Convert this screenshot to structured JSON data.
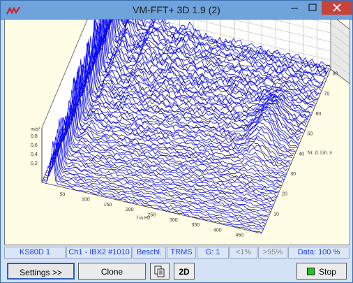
{
  "window": {
    "title": "VM-FFT+ 3D 1.9 (2)"
  },
  "plot": {
    "y_axis_label": "m/s²",
    "y_ticks": [
      "0,8",
      "0,6",
      "0,4",
      "0,2"
    ],
    "x_axis_label": "f in Hz",
    "x_ticks": [
      "50",
      "100",
      "150",
      "200",
      "250",
      "300",
      "350",
      "400",
      "450"
    ],
    "z_axis_label": "Nr. d. Lin. s",
    "z_ticks": [
      "10",
      "20",
      "30",
      "40",
      "50",
      "60",
      "70",
      "80"
    ],
    "trace_color": "#0000ff",
    "background_color": "#fffde6"
  },
  "status": {
    "sensor": "KS80D 1",
    "channel": "Ch1 - IBX2 #1010",
    "measure": "Beschl.",
    "mode": "TRMS",
    "gain": "G: 1",
    "low": "<1%",
    "high": ">95%",
    "data": "Data: 100 %"
  },
  "toolbar": {
    "settings": "Settings >>",
    "clone": "Clone",
    "view2d": "2D",
    "stop": "Stop"
  },
  "icons": {
    "app": "app-logo-icon",
    "copy": "copy-icon",
    "stop": "stop-indicator-icon"
  }
}
